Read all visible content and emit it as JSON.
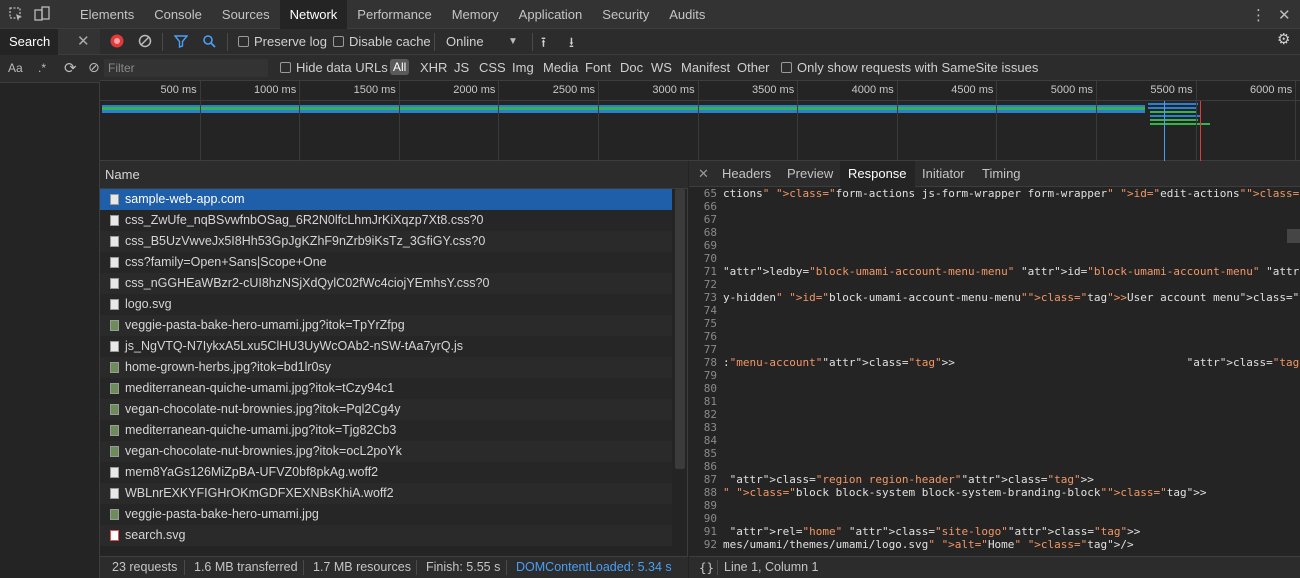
{
  "topbar": {
    "tabs": [
      "Elements",
      "Console",
      "Sources",
      "Network",
      "Performance",
      "Memory",
      "Application",
      "Security",
      "Audits"
    ],
    "active_tab": "Network"
  },
  "search_panel": {
    "tab_label": "Search",
    "case_label": "Aa",
    "regex_label": ".*"
  },
  "toolbar": {
    "preserve_log": "Preserve log",
    "disable_cache": "Disable cache",
    "throttle": "Online"
  },
  "filterbar": {
    "placeholder": "Filter",
    "hide_data_urls": "Hide data URLs",
    "types": [
      "All",
      "XHR",
      "JS",
      "CSS",
      "Img",
      "Media",
      "Font",
      "Doc",
      "WS",
      "Manifest",
      "Other"
    ],
    "samesite": "Only show requests with SameSite issues"
  },
  "overview": {
    "ticks": [
      "500 ms",
      "1000 ms",
      "1500 ms",
      "2000 ms",
      "2500 ms",
      "3000 ms",
      "3500 ms",
      "4000 ms",
      "4500 ms",
      "5000 ms",
      "5500 ms",
      "6000 ms"
    ]
  },
  "request_list": {
    "header": "Name",
    "rows": [
      {
        "name": "sample-web-app.com",
        "kind": "doc"
      },
      {
        "name": "css_ZwUfe_nqBSvwfnbOSag_6R2N0lfcLhmJrKiXqzp7Xt8.css?0",
        "kind": "doc"
      },
      {
        "name": "css_B5UzVwveJx5I8Hh53GpJgKZhF9nZrb9iKsTz_3GfiGY.css?0",
        "kind": "doc"
      },
      {
        "name": "css?family=Open+Sans|Scope+One",
        "kind": "doc"
      },
      {
        "name": "css_nGGHEaWBzr2-cUI8hzNSjXdQylC02fWc4ciojYEmhsY.css?0",
        "kind": "doc"
      },
      {
        "name": "logo.svg",
        "kind": "doc"
      },
      {
        "name": "veggie-pasta-bake-hero-umami.jpg?itok=TpYrZfpg",
        "kind": "img"
      },
      {
        "name": "js_NgVTQ-N7IykxA5Lxu5ClHU3UyWcOAb2-nSW-tAa7yrQ.js",
        "kind": "doc"
      },
      {
        "name": "home-grown-herbs.jpg?itok=bd1lr0sy",
        "kind": "img"
      },
      {
        "name": "mediterranean-quiche-umami.jpg?itok=tCzy94c1",
        "kind": "img"
      },
      {
        "name": "vegan-chocolate-nut-brownies.jpg?itok=Pql2Cg4y",
        "kind": "img"
      },
      {
        "name": "mediterranean-quiche-umami.jpg?itok=Tjg82Cb3",
        "kind": "img"
      },
      {
        "name": "vegan-chocolate-nut-brownies.jpg?itok=ocL2poYk",
        "kind": "img"
      },
      {
        "name": "mem8YaGs126MiZpBA-UFVZ0bf8pkAg.woff2",
        "kind": "doc"
      },
      {
        "name": "WBLnrEXKYFIGHrOKmGDFXEXNBsKhiA.woff2",
        "kind": "doc"
      },
      {
        "name": "veggie-pasta-bake-hero-umami.jpg",
        "kind": "img"
      },
      {
        "name": "search.svg",
        "kind": "svg"
      }
    ]
  },
  "detail": {
    "tabs": [
      "Headers",
      "Preview",
      "Response",
      "Initiator",
      "Timing"
    ],
    "active_tab": "Response",
    "code_lines": [
      {
        "n": "65",
        "t": "ctions\" class=\"form-actions js-form-wrapper form-wrapper\" id=\"edit-actions\"><input data-drupal"
      },
      {
        "n": "66",
        "t": ""
      },
      {
        "n": "67",
        "t": ""
      },
      {
        "n": "68",
        "t": ""
      },
      {
        "n": "69",
        "t": ""
      },
      {
        "n": "70",
        "t": ""
      },
      {
        "n": "71",
        "t": "ledby=\"block-umami-account-menu-menu\" id=\"block-umami-account-menu\" class=\"block block-menu"
      },
      {
        "n": "72",
        "t": ""
      },
      {
        "n": "73",
        "t": "y-hidden\" id=\"block-umami-account-menu-menu\">User account menu</h2>"
      },
      {
        "n": "74",
        "t": ""
      },
      {
        "n": "75",
        "t": ""
      },
      {
        "n": "76",
        "t": ""
      },
      {
        "n": "77",
        "t": ""
      },
      {
        "n": "78",
        "t": ":\"menu-account\">                                   <li class=\"menu-account__item\">"
      },
      {
        "n": "79",
        "t": ""
      },
      {
        "n": "80",
        "t": ""
      },
      {
        "n": "81",
        "t": ""
      },
      {
        "n": "82",
        "t": ""
      },
      {
        "n": "83",
        "t": ""
      },
      {
        "n": "84",
        "t": ""
      },
      {
        "n": "85",
        "t": ""
      },
      {
        "n": "86",
        "t": ""
      },
      {
        "n": "87",
        "t": " class=\"region region-header\">"
      },
      {
        "n": "88",
        "t": "\" class=\"block block-system block-system-branding-block\">"
      },
      {
        "n": "89",
        "t": ""
      },
      {
        "n": "90",
        "t": ""
      },
      {
        "n": "91",
        "t": " rel=\"home\" class=\"site-logo\">"
      },
      {
        "n": "92",
        "t": "mes/umami/themes/umami/logo.svg\" alt=\"Home\" />"
      }
    ]
  },
  "status": {
    "requests": "23 requests",
    "transferred": "1.6 MB transferred",
    "resources": "1.7 MB resources",
    "finish": "Finish: 5.55 s",
    "domcontentloaded": "DOMContentLoaded: 5.34 s",
    "cursor": "Line 1, Column 1"
  },
  "colors": {
    "accent": "#1f5ea8",
    "record": "#e03a3a",
    "dcl": "#4a9ff5"
  }
}
